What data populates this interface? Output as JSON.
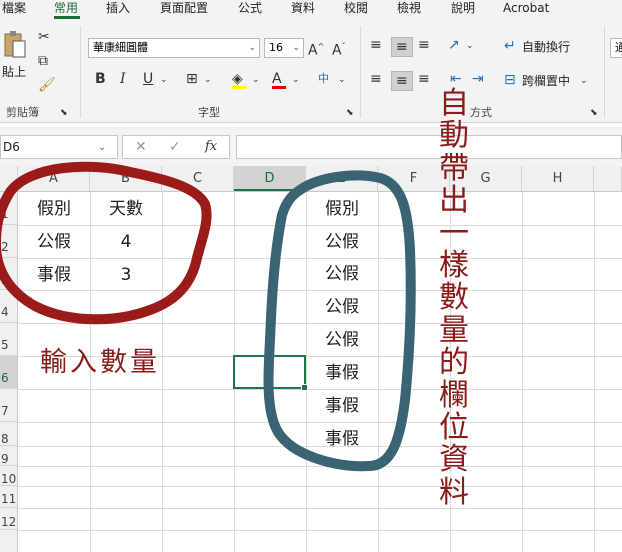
{
  "menu": {
    "tabs": [
      "檔案",
      "常用",
      "插入",
      "頁面配置",
      "公式",
      "資料",
      "校閱",
      "檢視",
      "說明",
      "Acrobat"
    ],
    "active": "常用"
  },
  "ribbon": {
    "clipboard": {
      "paste_label": "貼上",
      "group_label": "剪貼簿"
    },
    "font": {
      "font_name": "華康細圓體",
      "font_size": "16",
      "group_label": "字型",
      "bold": "B",
      "italic": "I",
      "underline": "U",
      "grow": "A^",
      "shrink": "Aˇ"
    },
    "alignment": {
      "wrap_text": "自動換行",
      "merge_center": "跨欄置中",
      "group_label": "方式"
    },
    "next_group_partial": "通"
  },
  "formula_bar": {
    "name_box": "D6",
    "cancel": "✕",
    "enter": "✓",
    "fx": "fx",
    "value": ""
  },
  "grid": {
    "columns": [
      "A",
      "B",
      "C",
      "D",
      "E",
      "F",
      "G",
      "H"
    ],
    "selected_column": "D",
    "rows": [
      "1",
      "2",
      "3",
      "4",
      "5",
      "6",
      "7",
      "8",
      "9",
      "10",
      "11",
      "12"
    ],
    "selected_row": "6",
    "cells_left": [
      {
        "a": "假別",
        "b": "天數"
      },
      {
        "a": "公假",
        "b": "4"
      },
      {
        "a": "事假",
        "b": "3"
      }
    ],
    "cells_e": [
      "假別",
      "公假",
      "公假",
      "公假",
      "公假",
      "事假",
      "事假",
      "事假"
    ]
  },
  "annotations": {
    "left_note": "輸入數量",
    "vertical_note": "自動帶出一樣數量的欄位資料",
    "left_circle_color": "#9b1b1b",
    "right_circle_color": "#3a6374",
    "text_color": "#8b1a1a"
  },
  "colors": {
    "excel_green": "#217346",
    "ribbon_bg": "#f3f3f3"
  }
}
